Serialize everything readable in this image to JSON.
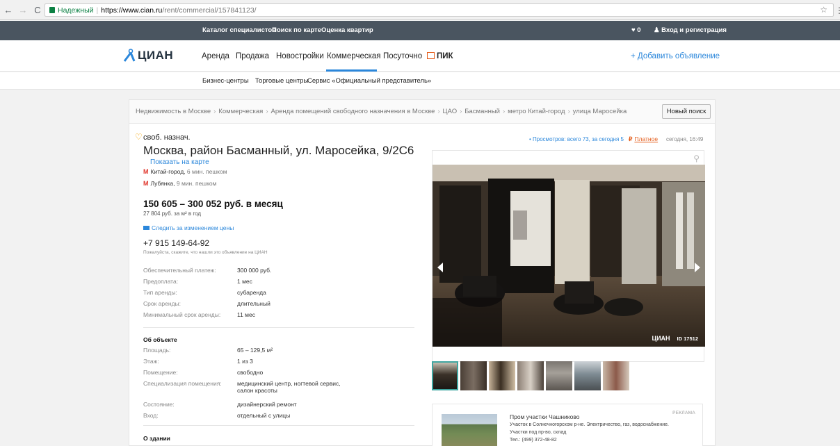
{
  "browser": {
    "secure_label": "Надежный",
    "url_host": "https://www.cian.ru",
    "url_path": "/rent/commercial/157841123/"
  },
  "topbar": {
    "links": [
      "Каталог специалистов",
      "Поиск по карте",
      "Оценка квартир"
    ],
    "favorites_count": "♥ 0",
    "login": "Вход и регистрация"
  },
  "nav": {
    "logo": "ЦИАН",
    "items": [
      "Аренда",
      "Продажа",
      "Новостройки",
      "Коммерческая",
      "Посуточно",
      "ПИК"
    ],
    "active": "Коммерческая",
    "add_ad": "+ Добавить объявление"
  },
  "subnav": [
    "Бизнес-центры",
    "Торговые центры",
    "Сервис «Официальный представитель»"
  ],
  "breadcrumbs": [
    "Недвижимость в Москве",
    "Коммерческая",
    "Аренда помещений свободного назначения в Москве",
    "ЦАО",
    "Басманный",
    "метро Китай-город",
    "улица Маросейка"
  ],
  "new_search": "Новый поиск",
  "listing": {
    "type": "своб. назнач.",
    "address": "Москва, район Басманный, ул. Маросейка, 9/2С6",
    "show_map": "Показать на карте",
    "metro": [
      {
        "station": "Китай-город,",
        "walk": "6 мин. пешком"
      },
      {
        "station": "Лубянка,",
        "walk": "9 мин. пешком"
      }
    ],
    "price": "150 605 – 300 052 руб. в месяц",
    "price_per_m2": "27 804 руб. за м² в год",
    "watch_price": "Следить за изменением цены",
    "phone": "+7 915 149-64-92",
    "phone_note": "Пожалуйста, скажите, что нашли это объявление на ЦИАН",
    "terms": [
      {
        "k": "Обеспечительный платеж:",
        "v": "300 000 руб."
      },
      {
        "k": "Предоплата:",
        "v": "1 мес"
      },
      {
        "k": "Тип аренды:",
        "v": "субаренда"
      },
      {
        "k": "Срок аренды:",
        "v": "длительный"
      },
      {
        "k": "Минимальный срок аренды:",
        "v": "11 мес"
      }
    ],
    "object_title": "Об объекте",
    "object": [
      {
        "k": "Площадь:",
        "v": "65 – 129,5 м²"
      },
      {
        "k": "Этаж:",
        "v": "1 из 3"
      },
      {
        "k": "Помещение:",
        "v": "свободно"
      },
      {
        "k": "Специализация помещения:",
        "v": "медицинский центр, ногтевой сервис, салон красоты"
      },
      {
        "k": "Состояние:",
        "v": "дизайнерский ремонт"
      },
      {
        "k": "Вход:",
        "v": "отдельный с улицы"
      }
    ],
    "building_title": "О здании"
  },
  "stats": {
    "views": "• Просмотров: всего 73, за сегодня 5",
    "paid_symbol": "₽",
    "paid": "Платное",
    "time": "сегодня, 16:49"
  },
  "gallery": {
    "watermark": "ЦИАН",
    "photo_id": "ID 17512",
    "thumb_count": 7
  },
  "ad": {
    "tag": "РЕКЛАМА",
    "title": "Пром участки Чашниково",
    "lines": [
      "Участок в Солнечногорском р-не. Электричество, газ, водоснабжение.",
      "Участки под пр-во, склад",
      "Тел.: (499) 372-48-82"
    ]
  },
  "colors": {
    "accent": "#2b87db",
    "topbar": "#4a5560",
    "price_orange": "#e45c1a"
  }
}
